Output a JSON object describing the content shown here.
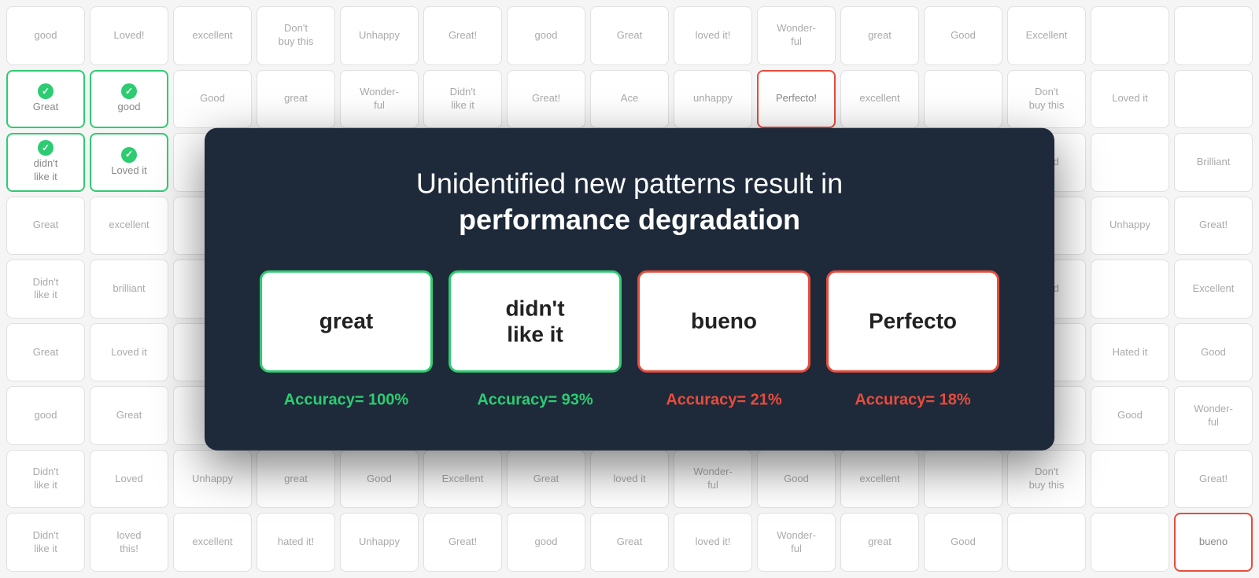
{
  "modal": {
    "title_line1": "Unidentified new patterns result in",
    "title_line2": "performance degradation",
    "cards": [
      {
        "label": "great",
        "border": "green",
        "accuracy": "Accuracy= 100%",
        "accuracy_color": "green"
      },
      {
        "label": "didn't\nlike it",
        "border": "green",
        "accuracy": "Accuracy= 93%",
        "accuracy_color": "green"
      },
      {
        "label": "bueno",
        "border": "red",
        "accuracy": "Accuracy= 21%",
        "accuracy_color": "red"
      },
      {
        "label": "Perfecto",
        "border": "red",
        "accuracy": "Accuracy= 18%",
        "accuracy_color": "red"
      }
    ]
  },
  "bg_chips": [
    "good",
    "Loved!",
    "excellent",
    "Don't\nbuy this",
    "Unhappy",
    "Great!",
    "good",
    "Great",
    "loved it!",
    "Wonder-\nful",
    "great",
    "Good",
    "Excellent",
    "",
    "",
    "Great",
    "good",
    "Good",
    "great",
    "Wonder-\nful",
    "Didn't\nlike it",
    "Great!",
    "Ace",
    "unhappy",
    "Perfecto!",
    "excellent",
    "",
    "Don't\nbuy this",
    "Loved it",
    "",
    "didn't\nlike it",
    "Loved it",
    "",
    "",
    "",
    "",
    "",
    "",
    "",
    "",
    "",
    "",
    "Good",
    "",
    "Brilliant",
    "Great",
    "excellent",
    "",
    "",
    "",
    "",
    "",
    "",
    "",
    "",
    "",
    "",
    "",
    "Unhappy",
    "Great!",
    "Didn't\nlike it",
    "brilliant",
    "",
    "",
    "",
    "",
    "",
    "",
    "",
    "",
    "",
    "",
    "Good",
    "",
    "Excellent",
    "Great",
    "Loved it",
    "",
    "",
    "",
    "",
    "",
    "",
    "",
    "",
    "",
    "",
    "",
    "Hated it",
    "Good",
    "good",
    "Great",
    "",
    "",
    "",
    "",
    "",
    "",
    "",
    "",
    "",
    "",
    "",
    "Good",
    "Wonder-\nful",
    "Didn't\nlike it",
    "Loved",
    "Unhappy",
    "great",
    "Good",
    "Excellent",
    "Great",
    "loved it",
    "Wonder-\nful",
    "Good",
    "excellent",
    "",
    "Don't\nbuy this",
    "",
    "Great!",
    "Didn't\nlike it",
    "loved\nthis!",
    "excellent",
    "hated it!",
    "Unhappy",
    "Great!",
    "good",
    "Great",
    "loved it!",
    "Wonder-\nful",
    "great",
    "Good",
    "",
    "",
    "bueno"
  ]
}
